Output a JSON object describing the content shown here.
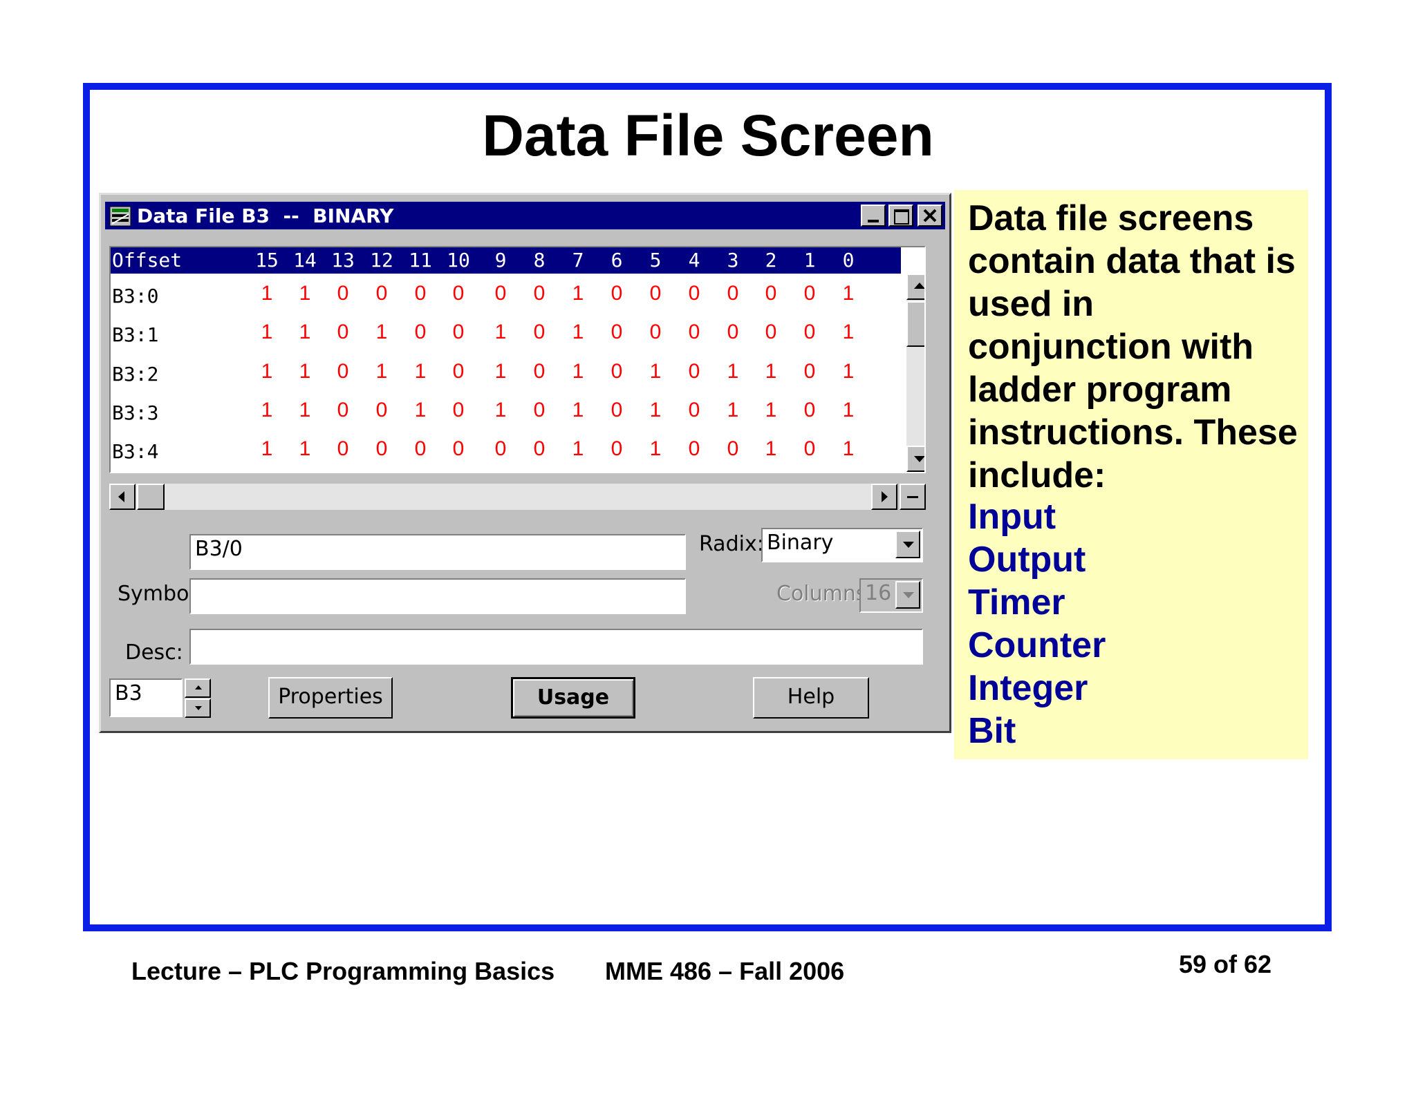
{
  "slide": {
    "title": "Data File Screen"
  },
  "window": {
    "title": "Data File B3  --  BINARY",
    "controls": [
      "minimize",
      "maximize",
      "close"
    ]
  },
  "grid": {
    "header": {
      "offset": "Offset",
      "bits": [
        "15",
        "14",
        "13",
        "12",
        "11",
        "10",
        "9",
        "8",
        "7",
        "6",
        "5",
        "4",
        "3",
        "2",
        "1",
        "0"
      ]
    },
    "rows": [
      {
        "offset": "B3:0",
        "bits": [
          "1",
          "1",
          "0",
          "0",
          "0",
          "0",
          "0",
          "0",
          "1",
          "0",
          "0",
          "0",
          "0",
          "0",
          "0",
          "1"
        ]
      },
      {
        "offset": "B3:1",
        "bits": [
          "1",
          "1",
          "0",
          "1",
          "0",
          "0",
          "1",
          "0",
          "1",
          "0",
          "0",
          "0",
          "0",
          "0",
          "0",
          "1"
        ]
      },
      {
        "offset": "B3:2",
        "bits": [
          "1",
          "1",
          "0",
          "1",
          "1",
          "0",
          "1",
          "0",
          "1",
          "0",
          "1",
          "0",
          "1",
          "1",
          "0",
          "1"
        ]
      },
      {
        "offset": "B3:3",
        "bits": [
          "1",
          "1",
          "0",
          "0",
          "1",
          "0",
          "1",
          "0",
          "1",
          "0",
          "1",
          "0",
          "1",
          "1",
          "0",
          "1"
        ]
      },
      {
        "offset": "B3:4",
        "bits": [
          "1",
          "1",
          "0",
          "0",
          "0",
          "0",
          "0",
          "0",
          "1",
          "0",
          "1",
          "0",
          "0",
          "1",
          "0",
          "1"
        ]
      }
    ],
    "bit_color": "#ff0000"
  },
  "form": {
    "address_value": "B3/0",
    "radix_label": "Radix:",
    "radix_value": "Binary",
    "symbol_label": "Symbol:",
    "symbol_value": "",
    "columns_label": "Columns:",
    "columns_value": "16",
    "desc_label": "Desc:",
    "desc_value": "",
    "file_value": "B3",
    "properties_button": "Properties",
    "usage_button": "Usage",
    "help_button": "Help"
  },
  "note": {
    "text": "Data file screens contain data that is used in conjunction with ladder program instructions. These include:",
    "items": [
      "Input",
      "Output",
      "Timer",
      "Counter",
      "Integer",
      "Bit"
    ],
    "item_color": "#000099"
  },
  "footer": {
    "lecture": "Lecture – PLC Programming Basics",
    "course": "MME 486 – Fall 2006",
    "page": "59 of 62"
  },
  "colors": {
    "frame": "#0b1ee6",
    "titlebar": "#000080",
    "note_bg": "#fefebe"
  }
}
